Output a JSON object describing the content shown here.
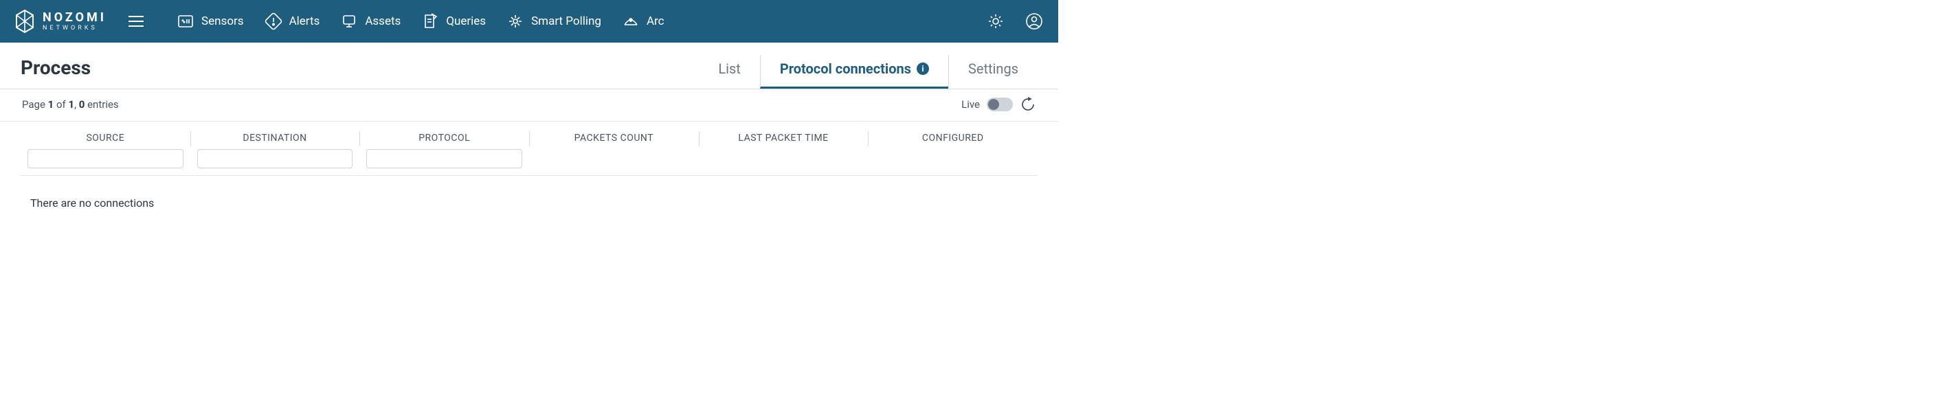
{
  "brand": {
    "line1": "NOZOMI",
    "line2": "NETWORKS"
  },
  "nav": {
    "sensors": "Sensors",
    "alerts": "Alerts",
    "assets": "Assets",
    "queries": "Queries",
    "smart_polling": "Smart Polling",
    "arc": "Arc"
  },
  "page": {
    "title": "Process"
  },
  "tabs": {
    "list": {
      "label": "List",
      "active": false
    },
    "proto": {
      "label": "Protocol connections",
      "active": true
    },
    "settings": {
      "label": "Settings",
      "active": false
    }
  },
  "pagination": {
    "prefix": "Page ",
    "page": "1",
    "of": " of ",
    "total_pages": "1",
    "sep": ", ",
    "entries": "0",
    "suffix": " entries"
  },
  "live": {
    "label": "Live"
  },
  "columns": {
    "source": {
      "label": "SOURCE",
      "has_input": true,
      "value": ""
    },
    "destination": {
      "label": "DESTINATION",
      "has_input": true,
      "value": ""
    },
    "protocol": {
      "label": "PROTOCOL",
      "has_input": true,
      "value": ""
    },
    "packets": {
      "label": "PACKETS COUNT",
      "has_input": false
    },
    "lastpkt": {
      "label": "LAST PACKET TIME",
      "has_input": false
    },
    "configured": {
      "label": "CONFIGURED",
      "has_input": false
    }
  },
  "empty_message": "There are no connections"
}
